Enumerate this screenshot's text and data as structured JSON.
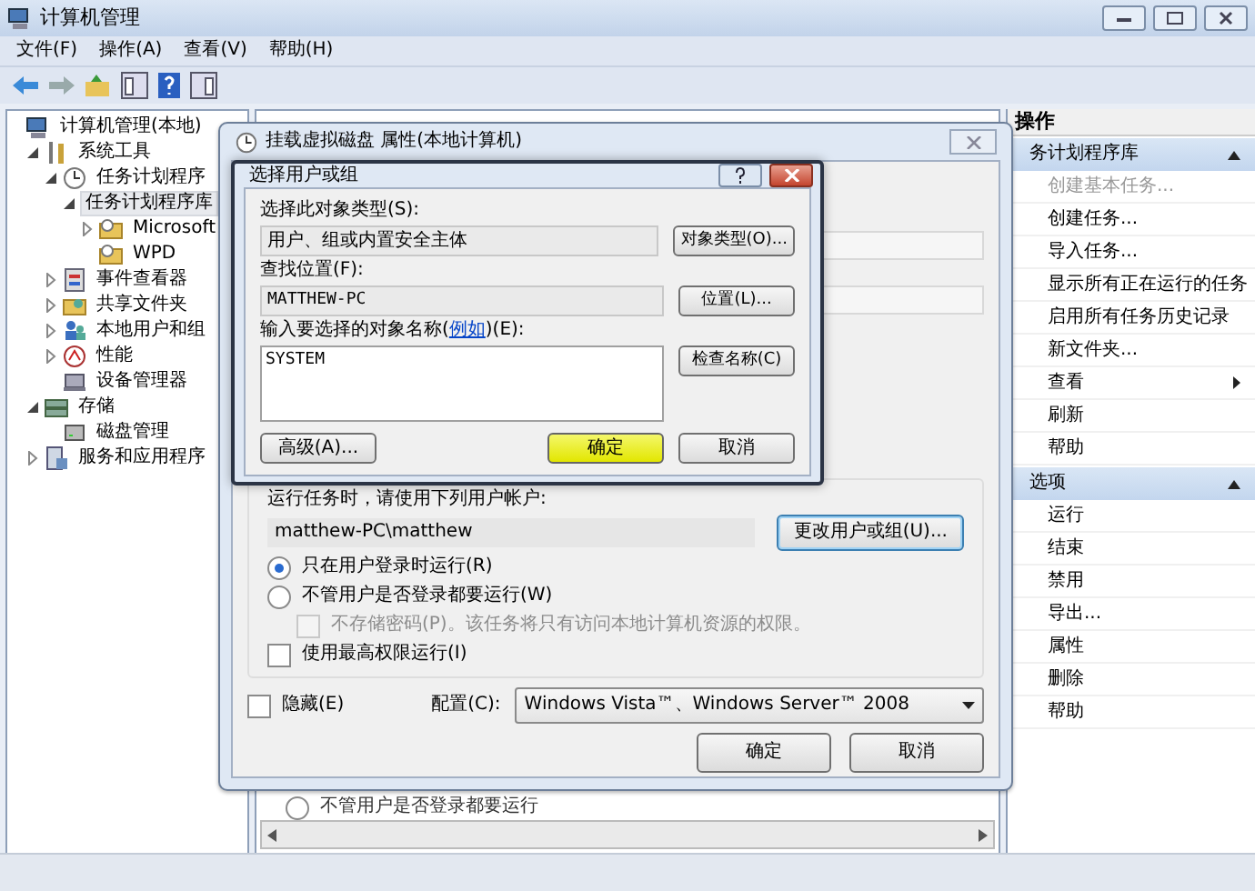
{
  "window": {
    "title": "计算机管理",
    "menu": [
      "文件(F)",
      "操作(A)",
      "查看(V)",
      "帮助(H)"
    ]
  },
  "tree": [
    {
      "label": "计算机管理(本地)",
      "kind": "computer",
      "selected": false,
      "children": [
        {
          "label": "系统工具",
          "kind": "tools",
          "expanded": true,
          "selected": false,
          "children": [
            {
              "label": "任务计划程序",
              "kind": "clock",
              "expanded": true,
              "selected": false,
              "children": [
                {
                  "label": "任务计划程序库",
                  "expanded": true,
                  "selected": true,
                  "children": [
                    {
                      "label": "Microsoft",
                      "kind": "task-folder",
                      "expanded": false,
                      "selected": false
                    },
                    {
                      "label": "WPD",
                      "kind": "task-folder",
                      "selected": false
                    }
                  ]
                }
              ]
            },
            {
              "label": "事件查看器",
              "kind": "event",
              "expanded": false,
              "selected": false
            },
            {
              "label": "共享文件夹",
              "kind": "share",
              "expanded": false,
              "selected": false
            },
            {
              "label": "本地用户和组",
              "kind": "users",
              "expanded": false,
              "selected": false
            },
            {
              "label": "性能",
              "kind": "performance",
              "expanded": false,
              "selected": false
            },
            {
              "label": "设备管理器",
              "kind": "device",
              "selected": false
            }
          ]
        },
        {
          "label": "存储",
          "kind": "storage",
          "expanded": true,
          "selected": false,
          "children": [
            {
              "label": "磁盘管理",
              "kind": "disk",
              "selected": false
            }
          ]
        },
        {
          "label": "服务和应用程序",
          "kind": "services",
          "expanded": false,
          "selected": false
        }
      ]
    }
  ],
  "background_row": {
    "label": "不管用户是否登录都要运行",
    "selected": false
  },
  "actions": {
    "title": "操作",
    "sections": [
      {
        "title": "务计划程序库",
        "expanded": true,
        "items": [
          {
            "label": "创建基本任务...",
            "kind": "command",
            "disabled": true
          },
          {
            "label": "创建任务...",
            "kind": "command",
            "disabled": false
          },
          {
            "label": "导入任务...",
            "kind": "command",
            "disabled": false
          },
          {
            "label": "显示所有正在运行的任务",
            "kind": "command",
            "disabled": false
          },
          {
            "label": "启用所有任务历史记录",
            "kind": "command",
            "disabled": false
          },
          {
            "label": "新文件夹...",
            "kind": "command",
            "disabled": false
          },
          {
            "label": "查看",
            "kind": "submenu",
            "disabled": false
          },
          {
            "label": "刷新",
            "kind": "command",
            "disabled": false
          },
          {
            "label": "帮助",
            "kind": "command",
            "disabled": false
          }
        ]
      },
      {
        "title": "选项",
        "expanded": true,
        "items": [
          {
            "label": "运行",
            "kind": "command",
            "disabled": false
          },
          {
            "label": "结束",
            "kind": "command",
            "disabled": false
          },
          {
            "label": "禁用",
            "kind": "command",
            "disabled": false
          },
          {
            "label": "导出...",
            "kind": "command",
            "disabled": false
          },
          {
            "label": "属性",
            "kind": "command",
            "disabled": false
          },
          {
            "label": "删除",
            "kind": "command",
            "disabled": false
          },
          {
            "label": "帮助",
            "kind": "command",
            "disabled": false
          }
        ]
      }
    ]
  },
  "properties_dialog": {
    "title": "挂载虚拟磁盘 属性(本地计算机)",
    "account_label": "运行任务时，请使用下列用户帐户:",
    "account": "matthew-PC\\matthew",
    "change_button": "更改用户或组(U)...",
    "run_options": [
      {
        "label": "只在用户登录时运行(R)",
        "selected": true
      },
      {
        "label": "不管用户是否登录都要运行(W)",
        "selected": false
      }
    ],
    "no_store_password": {
      "label": "不存储密码(P)。该任务将只有访问本地计算机资源的权限。",
      "checked": false,
      "disabled": true
    },
    "highest_privileges": {
      "label": "使用最高权限运行(I)",
      "checked": false
    },
    "hidden": {
      "label": "隐藏(E)",
      "checked": false
    },
    "configure_label": "配置(C):",
    "configure_value": "Windows Vista™、Windows Server™ 2008",
    "buttons": [
      "确定",
      "取消"
    ]
  },
  "select_dialog": {
    "title": "选择用户或组",
    "object_type_label": "选择此对象类型(S):",
    "object_type": "用户、组或内置安全主体",
    "object_type_button": "对象类型(O)...",
    "location_label": "查找位置(F):",
    "location": "MATTHEW-PC",
    "location_button": "位置(L)...",
    "names_label_start": "输入要选择的对象名称(",
    "example_link": "例如",
    "names_label_end": ")(E):",
    "names_value": "SYSTEM",
    "check_names_button": "检查名称(C)",
    "advanced_button": "高级(A)...",
    "ok_button": "确定",
    "cancel_button": "取消"
  }
}
